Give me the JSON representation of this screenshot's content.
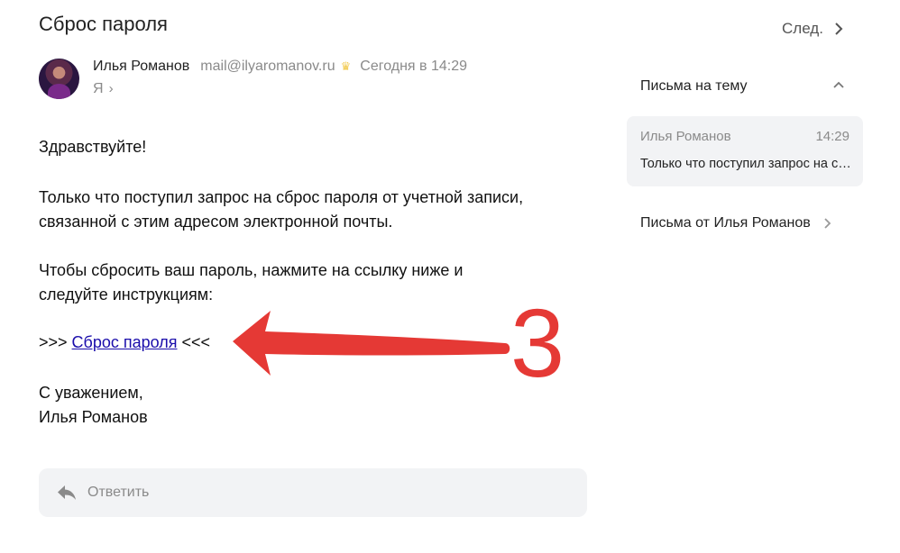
{
  "message": {
    "subject": "Сброс пароля",
    "sender_name": "Илья Романов",
    "sender_email": "mail@ilyaromanov.ru",
    "sent_time": "Сегодня в 14:29",
    "recipient": "Я",
    "body": {
      "greeting": "Здравствуйте!",
      "paragraph1_line1": "Только что поступил запрос на сброс пароля от учетной записи,",
      "paragraph1_line2": "связанной с этим адресом электронной почты.",
      "paragraph2_line1": "Чтобы сбросить ваш пароль, нажмите на ссылку ниже и",
      "paragraph2_line2": "следуйте инструкциям:",
      "link_prefix": ">>> ",
      "link_text": "Сброс пароля",
      "link_suffix": " <<<",
      "signoff_line1": "С уважением,",
      "signoff_line2": "Илья Романов"
    }
  },
  "reply": {
    "label": "Ответить"
  },
  "sidebar": {
    "next_label": "След.",
    "thread_title": "Письма на тему",
    "thread_item": {
      "sender": "Илья Романов",
      "time": "14:29",
      "snippet": "Только что поступил запрос на сброс пароля от учетной записи"
    },
    "from_sender_link": "Письма от Илья Романов"
  },
  "annotation": {
    "number": "3",
    "color": "#e53935"
  },
  "icons": {
    "verified": "crown-icon",
    "reply": "reply-icon",
    "next": "chevron-right-icon",
    "collapse": "chevron-up-icon"
  }
}
